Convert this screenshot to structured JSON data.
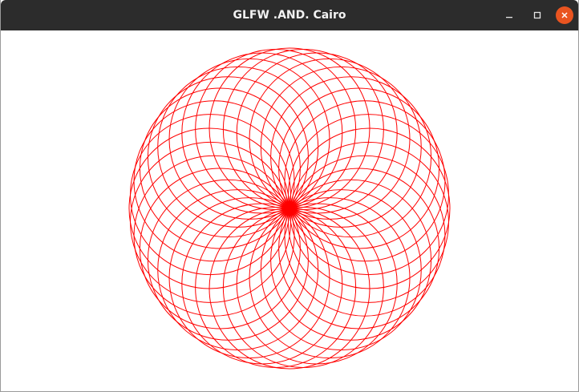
{
  "window": {
    "title": "GLFW .AND. Cairo"
  },
  "titlebar_buttons": [
    {
      "name": "minimize",
      "icon": "minimize-icon"
    },
    {
      "name": "maximize",
      "icon": "maximize-icon"
    },
    {
      "name": "close",
      "icon": "close-icon"
    }
  ],
  "colors": {
    "titlebar": "#2c2c2c",
    "title_text": "#f2f2f2",
    "close_button": "#e95420",
    "drawing_stroke": "#ff0000",
    "canvas_background": "#ffffff"
  },
  "drawing": {
    "shape": "circle rosette",
    "circle_count": 36
  }
}
